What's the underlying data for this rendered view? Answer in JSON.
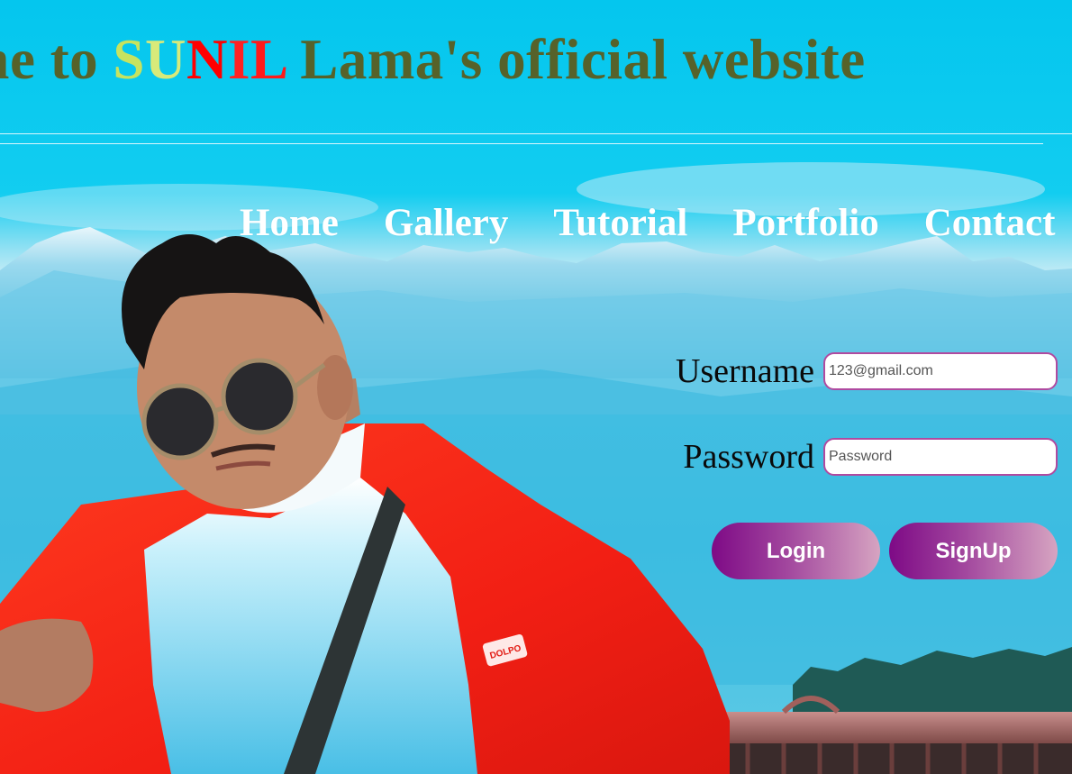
{
  "header": {
    "title_prefix": "me to ",
    "title_letters": [
      "S",
      "U",
      "N",
      "I",
      "L"
    ],
    "title_suffix": " Lama's official website"
  },
  "nav": {
    "items": [
      {
        "label": "Home"
      },
      {
        "label": "Gallery"
      },
      {
        "label": "Tutorial"
      },
      {
        "label": "Portfolio"
      },
      {
        "label": "Contact"
      }
    ]
  },
  "login": {
    "username_label": "Username",
    "username_placeholder": "123@gmail.com",
    "password_label": "Password",
    "password_placeholder": "Password",
    "login_button": "Login",
    "signup_button": "SignUp"
  },
  "photo": {
    "jacket_brand": "DOLPO"
  },
  "colors": {
    "title_text": "#56622a",
    "title_highlight_yellow": "#c7e35f",
    "title_highlight_red": "#ff0000",
    "button_gradient_start": "#7e0a86",
    "button_gradient_end": "#d6a4c1",
    "input_border": "#b04aa0"
  }
}
